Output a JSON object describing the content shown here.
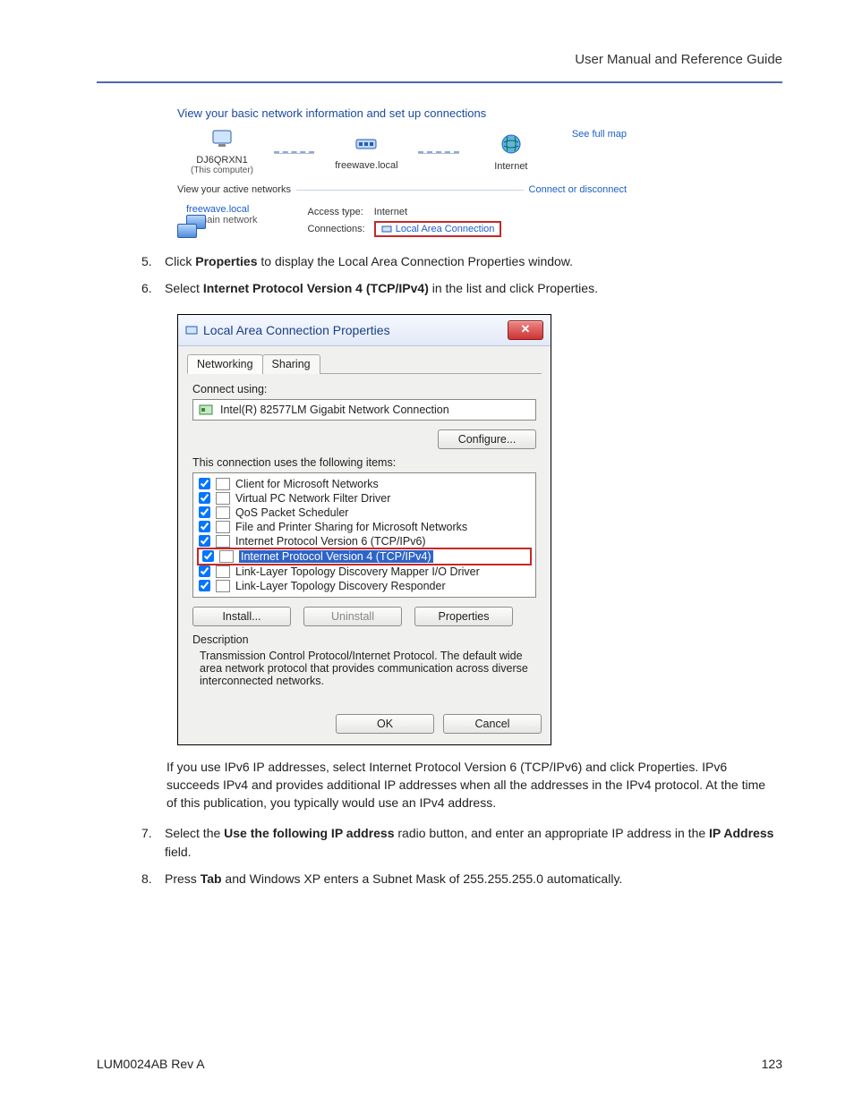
{
  "header": {
    "title": "User Manual and Reference Guide"
  },
  "footer": {
    "left": "LUM0024AB Rev A",
    "right": "123"
  },
  "steps": {
    "s5_a": "Click ",
    "s5_b": "Properties",
    "s5_c": " to display the Local Area Connection Properties window.",
    "s6_a": "Select ",
    "s6_b": "Internet Protocol Version 4 (TCP/IPv4)",
    "s6_c": " in the list and click Properties.",
    "note": "If you use IPv6 IP addresses, select Internet Protocol Version 6 (TCP/IPv6) and click Properties. IPv6 succeeds IPv4 and provides additional IP addresses when all the addresses in the IPv4 protocol. At the time of this publication, you typically would use an IPv4 address.",
    "s7_a": "Select the ",
    "s7_b": "Use the following IP address",
    "s7_c": " radio button, and enter an appropriate IP address in the ",
    "s7_d": "IP Address",
    "s7_e": " field.",
    "s8_a": "Press ",
    "s8_b": "Tab",
    "s8_c": "  and Windows XP enters a Subnet Mask of 255.255.255.0 automatically."
  },
  "netmap": {
    "title": "View your basic network information and set up connections",
    "node1": "DJ6QRXN1",
    "node1_sub": "(This computer)",
    "node2": "freewave.local",
    "node3": "Internet",
    "fullmap": "See full map",
    "active_label": "View your active networks",
    "connect_link": "Connect or disconnect",
    "net_name": "freewave.local",
    "net_type": "Domain network",
    "access_label": "Access type:",
    "access_value": "Internet",
    "conn_label": "Connections:",
    "conn_value": "Local Area Connection"
  },
  "dialog": {
    "title": "Local Area Connection Properties",
    "tab1": "Networking",
    "tab2": "Sharing",
    "connect_using": "Connect using:",
    "adapter": "Intel(R) 82577LM Gigabit Network Connection",
    "configure": "Configure...",
    "uses_label": "This connection uses the following items:",
    "items": [
      "Client for Microsoft Networks",
      "Virtual PC Network Filter Driver",
      "QoS Packet Scheduler",
      "File and Printer Sharing for Microsoft Networks",
      "Internet Protocol Version 6 (TCP/IPv6)",
      "Internet Protocol Version 4 (TCP/IPv4)",
      "Link-Layer Topology Discovery Mapper I/O Driver",
      "Link-Layer Topology Discovery Responder"
    ],
    "install": "Install...",
    "uninstall": "Uninstall",
    "properties": "Properties",
    "desc_title": "Description",
    "desc_body": "Transmission Control Protocol/Internet Protocol. The default wide area network protocol that provides communication across diverse interconnected networks.",
    "ok": "OK",
    "cancel": "Cancel"
  }
}
